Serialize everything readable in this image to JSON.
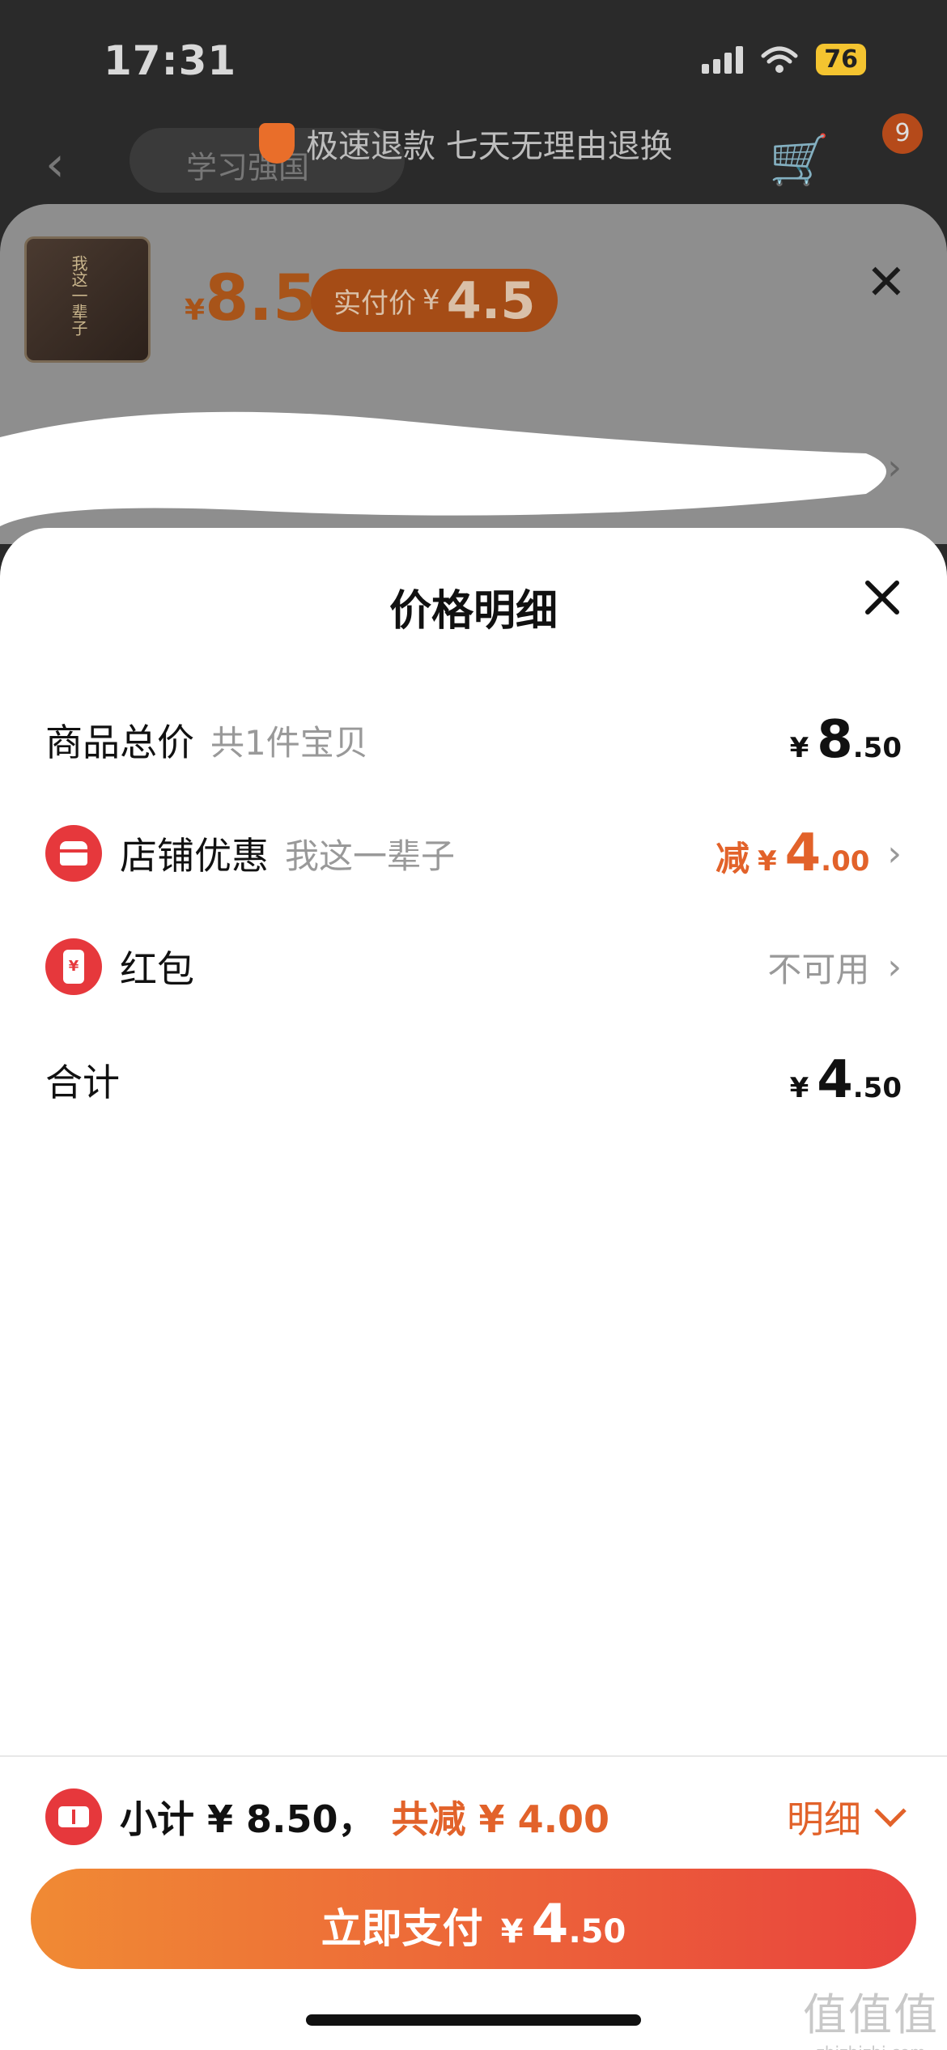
{
  "status_bar": {
    "time": "17:31",
    "battery": "76"
  },
  "background": {
    "search_placeholder": "学习强国",
    "notice": "极速退款 七天无理由退换",
    "cart_badge": "9"
  },
  "sku": {
    "book_title": "我这一辈子",
    "price_symbol": "¥",
    "price": "8.5",
    "pill_label": "实付价",
    "pill_symbol": "¥",
    "pill_value": "4.5"
  },
  "sheet": {
    "title": "价格明细",
    "rows": [
      {
        "label": "商品总价",
        "sub": "共1件宝贝",
        "symbol": "¥",
        "int": "8",
        "dec": ".50"
      },
      {
        "label": "店铺优惠",
        "sub": "我这一辈子",
        "prefix": "减",
        "symbol": "¥",
        "int": "4",
        "dec": ".00"
      },
      {
        "label": "红包",
        "value": "不可用"
      },
      {
        "label": "合计",
        "symbol": "¥",
        "int": "4",
        "dec": ".50"
      }
    ],
    "hongbao_glyph": "¥"
  },
  "bottom": {
    "subtotal": "小计 ¥ 8.50，",
    "savings": "共减 ¥ 4.00",
    "detail_label": "明细",
    "pay_label": "立即支付",
    "pay_symbol": "¥",
    "pay_int": "4",
    "pay_dec": ".50"
  },
  "watermark": {
    "logo": "值值值",
    "url": "zhizhizhi.com"
  },
  "colors": {
    "accent": "#e2622a",
    "icon_red": "#e6383c",
    "button_start": "#f08a34",
    "button_end": "#e9433d"
  }
}
